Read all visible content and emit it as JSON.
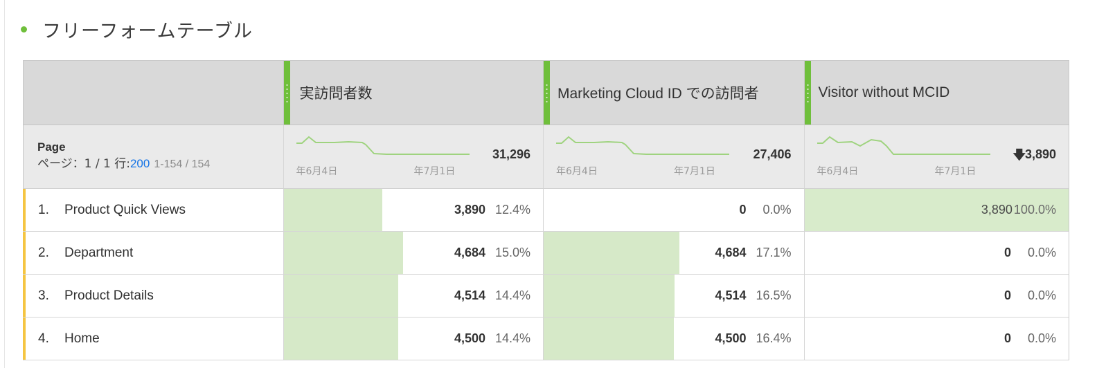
{
  "panel": {
    "title": "フリーフォームテーブル",
    "accent_color": "#6fbf3b"
  },
  "table": {
    "dimension": {
      "name": "Page",
      "pager_prefix": "ページ：1 / 1 行:",
      "rows_per_page": "200",
      "range": "1-154 / 154"
    },
    "metrics": [
      {
        "label": "実訪問者数",
        "total": "31,296",
        "spark_start": "年6月4日",
        "spark_end": "年7月1日"
      },
      {
        "label": "Marketing Cloud ID での訪問者",
        "total": "27,406",
        "spark_start": "年6月4日",
        "spark_end": "年7月1日"
      },
      {
        "label": "Visitor without MCID",
        "total": "3,890",
        "total_icon": "down-arrow-icon",
        "spark_start": "年6月4日",
        "spark_end": "年7月1日"
      }
    ],
    "rows": [
      {
        "rank": "1.",
        "name": "Product Quick Views",
        "cells": [
          {
            "value": "3,890",
            "pct": "12.4%",
            "fraction": 0.124
          },
          {
            "value": "0",
            "pct": "0.0%",
            "fraction": 0
          },
          {
            "value": "3,890",
            "pct": "100.0%",
            "fraction": 1.0
          }
        ]
      },
      {
        "rank": "2.",
        "name": "Department",
        "cells": [
          {
            "value": "4,684",
            "pct": "15.0%",
            "fraction": 0.15
          },
          {
            "value": "4,684",
            "pct": "17.1%",
            "fraction": 0.171
          },
          {
            "value": "0",
            "pct": "0.0%",
            "fraction": 0
          }
        ]
      },
      {
        "rank": "3.",
        "name": "Product Details",
        "cells": [
          {
            "value": "4,514",
            "pct": "14.4%",
            "fraction": 0.144
          },
          {
            "value": "4,514",
            "pct": "16.5%",
            "fraction": 0.165
          },
          {
            "value": "0",
            "pct": "0.0%",
            "fraction": 0
          }
        ]
      },
      {
        "rank": "4.",
        "name": "Home",
        "cells": [
          {
            "value": "4,500",
            "pct": "14.4%",
            "fraction": 0.144
          },
          {
            "value": "4,500",
            "pct": "16.4%",
            "fraction": 0.164
          },
          {
            "value": "0",
            "pct": "0.0%",
            "fraction": 0
          }
        ]
      }
    ]
  },
  "colors": {
    "bar_fill": "#d6e9c8",
    "row_marker": "#f5c542",
    "link": "#1473e6",
    "sparkline": "#9fd37f"
  }
}
